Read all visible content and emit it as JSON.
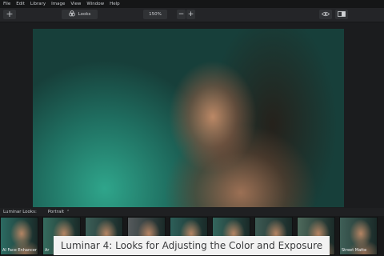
{
  "menu": [
    "File",
    "Edit",
    "Library",
    "Image",
    "View",
    "Window",
    "Help"
  ],
  "toolbar": {
    "add_label": "+",
    "looks_label": "Looks",
    "zoom_value": "150%",
    "zoom_out": "−",
    "zoom_in": "+",
    "eye_icon": "eye-icon",
    "compare_icon": "compare-icon"
  },
  "photo": {
    "subject": "portrait"
  },
  "looks_panel": {
    "label": "Luminar Looks:",
    "category": "Portrait",
    "chevron": "⌃"
  },
  "thumbnails": [
    {
      "label": "AI Face Enhancer",
      "tone": "#2c6b62"
    },
    {
      "label": "Ar",
      "tone": "#366c5e"
    },
    {
      "label": "",
      "tone": "#3c5f58"
    },
    {
      "label": "",
      "tone": "#555a5c"
    },
    {
      "label": "",
      "tone": "#2d5f59"
    },
    {
      "label": "",
      "tone": "#34665d"
    },
    {
      "label": "",
      "tone": "#3d5a53"
    },
    {
      "label": "",
      "tone": "#4e6a5c"
    },
    {
      "label": "Street Matte",
      "tone": "#3f5f57"
    }
  ],
  "caption": "Luminar 4: Looks for Adjusting the Color and Exposure",
  "colors": {
    "background": "#1b1c1e",
    "toolbar": "#242528",
    "photo_background": "#1d6a5c",
    "caption_background": "#f2f2f2"
  }
}
